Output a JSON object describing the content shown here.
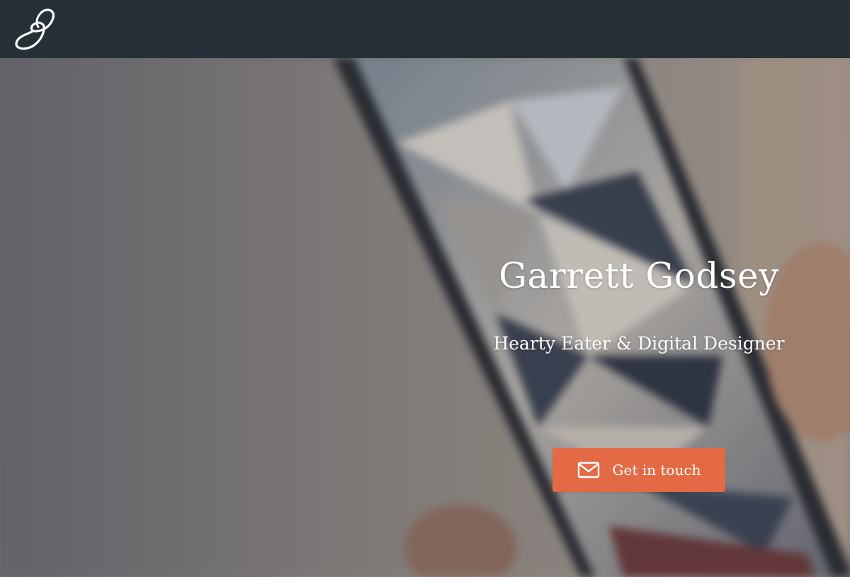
{
  "header": {
    "logo_alt": "G"
  },
  "hero": {
    "title": "Garrett Godsey",
    "subtitle": "Hearty Eater & Digital Designer",
    "cta_label": "Get in touch",
    "cta_icon": "mail-icon"
  },
  "colors": {
    "topbar": "#263037",
    "cta": "#e36a44",
    "text": "#ffffff"
  }
}
